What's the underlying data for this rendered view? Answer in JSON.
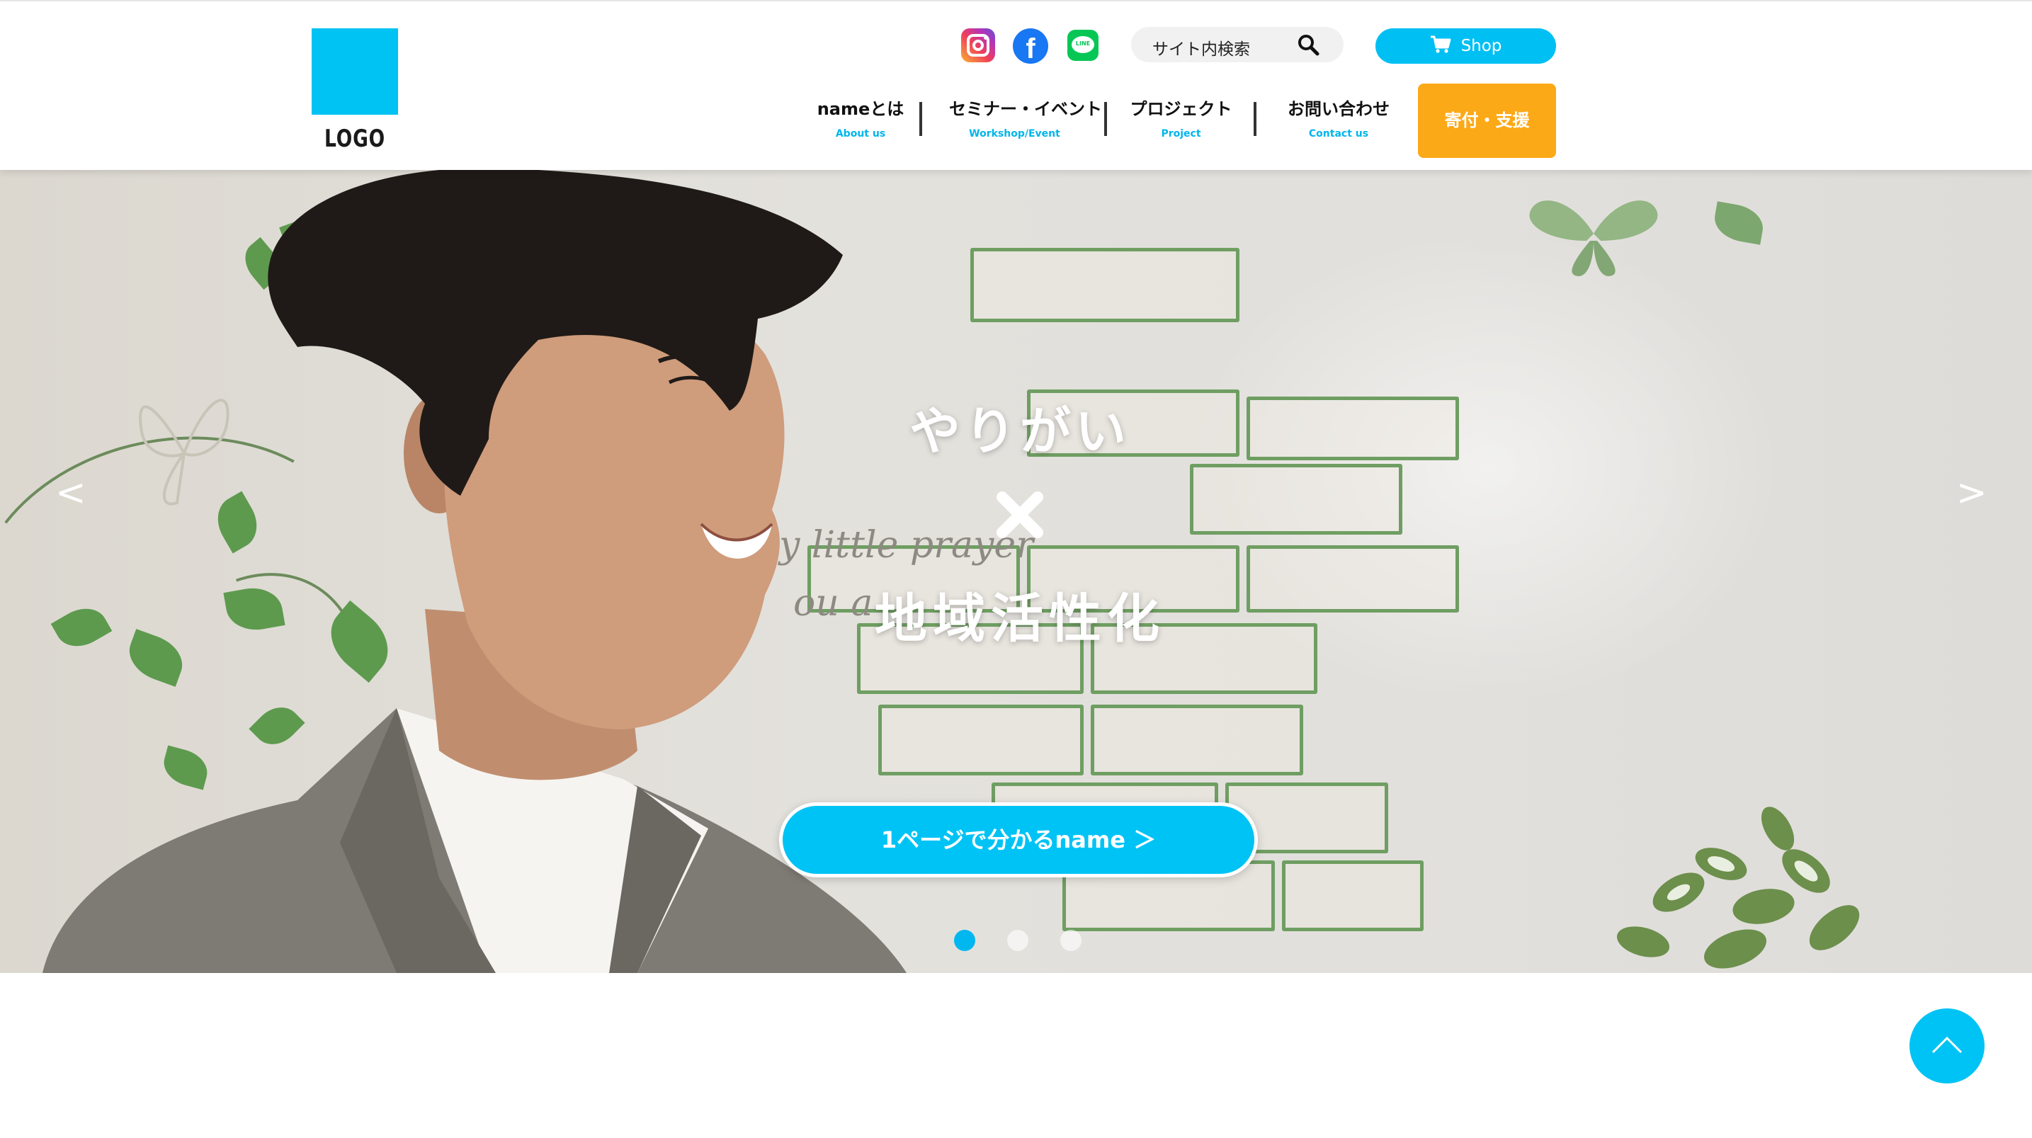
{
  "logo": {
    "text": "LOGO"
  },
  "header": {
    "social": [
      {
        "name": "instagram-icon"
      },
      {
        "name": "facebook-icon",
        "glyph": "f"
      },
      {
        "name": "line-icon",
        "glyph": "LINE"
      }
    ],
    "search": {
      "label": "サイト内検索"
    },
    "shop": {
      "label": "Shop"
    },
    "nav": [
      {
        "ja": "nameとは",
        "en": "About us"
      },
      {
        "ja": "セミナー・イベント",
        "en": "Workshop/Event"
      },
      {
        "ja": "プロジェクト",
        "en": "Project"
      },
      {
        "ja": "お問い合わせ",
        "en": "Contact us"
      }
    ],
    "donate": {
      "label": "寄付・支援"
    }
  },
  "hero": {
    "line1": "やりがい",
    "line2": "地域活性化",
    "cta": "1ページで分かるname ＞",
    "prev": "<",
    "next": ">",
    "wall_text_1": "y little prayer",
    "wall_text_2": "ou a",
    "slides": {
      "count": 3,
      "active": 1
    }
  },
  "colors": {
    "accent": "#00c3f5",
    "donate": "#fca918",
    "instagram": "#e1306c",
    "facebook": "#1877f2",
    "line": "#06c755"
  }
}
